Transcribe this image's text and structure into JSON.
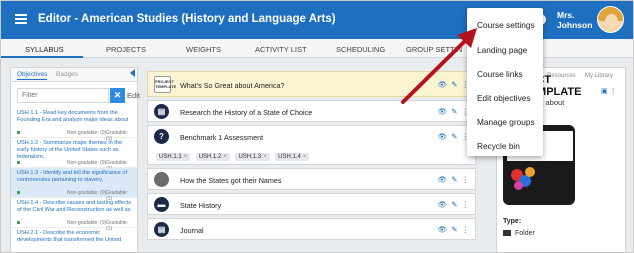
{
  "header": {
    "title": "Editor - American Studies (History and Language Arts)",
    "user_name_line1": "Mrs.",
    "user_name_line2": "Johnson",
    "help_glyph": "?"
  },
  "tabs": [
    "SYLLABUS",
    "PROJECTS",
    "WEIGHTS",
    "ACTIVITY LIST",
    "SCHEDULING",
    "GROUP SETTIN"
  ],
  "left_panel": {
    "tabs": [
      "Objectives",
      "Badges"
    ],
    "filter_placeholder": "Filter",
    "clear_glyph": "✕",
    "edit_label": "Edit",
    "objectives": [
      {
        "text": "USH.1.1 - Read key documents from the Founding Era and analyze major ideas about",
        "non_gradable": "Non-gradable: (0)",
        "gradable": "Gradable: (1)",
        "selected": false
      },
      {
        "text": "USH.1.2 - Summarize major themes in the early history of the United States such as federalism,",
        "non_gradable": "Non-gradable: (0)",
        "gradable": "Gradable: (1)",
        "selected": false
      },
      {
        "text": "USH.1.3 - Identify and tell the significance of controversies pertaining to slavery,",
        "non_gradable": "Non-gradable: (0)",
        "gradable": "Gradable: (1)",
        "selected": true
      },
      {
        "text": "USH.1.4 - Describe causes and lasting effects of the Civil War and Reconstruction as well as",
        "non_gradable": "Non-gradable: (0)",
        "gradable": "Gradable: (1)",
        "selected": false
      },
      {
        "text": "USH.2.1 - Describe the economic developments that transformed the United",
        "non_gradable": "",
        "gradable": "",
        "selected": false
      }
    ]
  },
  "activities": [
    {
      "title": "What's So Great about America?",
      "icon": "project-template-thumb-icon",
      "icon_text": "PROJECT TEMPLATE"
    },
    {
      "title": "Research the History of a State of Choice",
      "icon": "document-icon",
      "icon_text": "▤"
    },
    {
      "title": "Benchmark 1 Assessment",
      "icon": "question-icon",
      "icon_text": "?",
      "tags": [
        "USH.1.1",
        "USH.1.2",
        "USH.1.3",
        "USH.1.4"
      ],
      "tag_close": "×"
    },
    {
      "title": "How the States got their Names",
      "icon": "video-thumb-icon",
      "icon_text": ""
    },
    {
      "title": "State History",
      "icon": "discussion-icon",
      "icon_text": "▬"
    },
    {
      "title": "Journal",
      "icon": "journal-icon",
      "icon_text": "▤"
    }
  ],
  "row_actions": {
    "view": "👁",
    "edit": "✎",
    "more": "⋮"
  },
  "right_panel": {
    "tabs": [
      "Resources",
      "My Library"
    ],
    "preview_text": "eat about",
    "tile_title_1": "JECT",
    "tile_title_2": "TEMPLATE",
    "type_label": "Type:",
    "type_value": "Folder",
    "image_glyph": "▣",
    "more_glyph": "⋮"
  },
  "menu": {
    "items": [
      "Course settings",
      "Landing page",
      "Course links",
      "Edit objectives",
      "Manage groups",
      "Recycle bin"
    ]
  },
  "colors": {
    "brand": "#1f6fc0",
    "arrow": "#b5121b",
    "highlight_row": "#fbf4d3",
    "selected_objective": "#dbe8f6"
  }
}
